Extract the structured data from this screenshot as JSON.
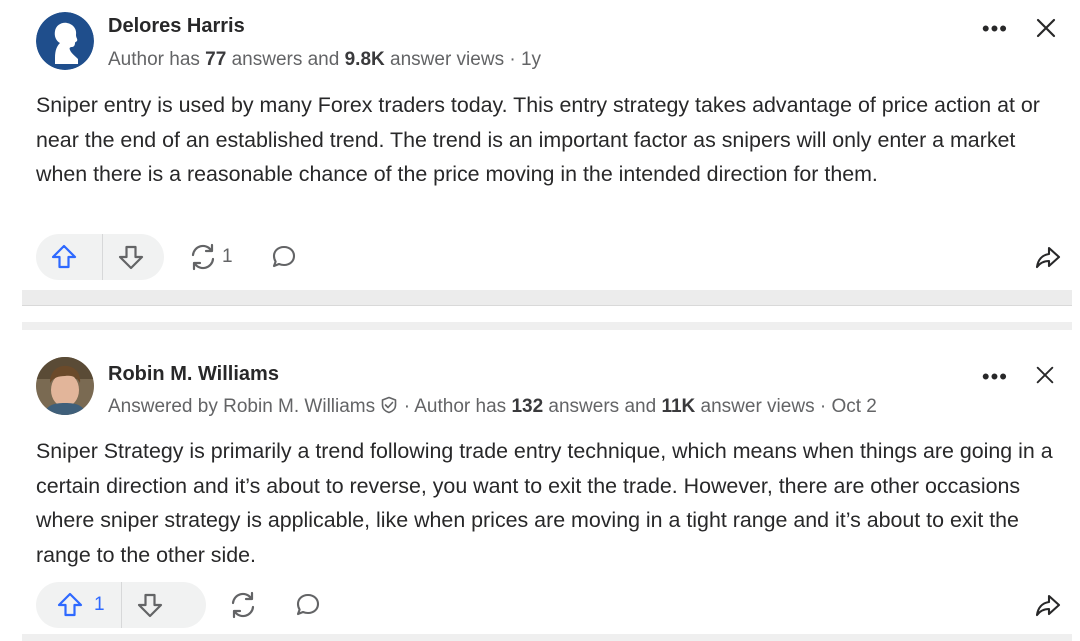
{
  "answers": [
    {
      "author": "Delores Harris",
      "meta_prefix": "Author has ",
      "answer_count": "77",
      "meta_mid": " answers and ",
      "view_count": "9.8K",
      "meta_suffix": " answer views · 1y",
      "body": "Sniper entry is used by many Forex traders today. This entry strategy takes advantage of price action at or near the end of an established trend. The trend is an important factor as snipers will only enter a market when there is a reasonable chance of the price moving in the intended direction for them.",
      "upvotes": "",
      "shares": "1",
      "more_label": "•••"
    },
    {
      "author": "Robin M. Williams",
      "answered_by": "Answered by Robin M. Williams",
      "meta_prefix": " · Author has ",
      "answer_count": "132",
      "meta_mid": " answers and ",
      "view_count": "11K",
      "meta_suffix": " answer views · Oct 2",
      "body": "Sniper Strategy is primarily a trend following trade entry technique, which means when things are going in a certain direction and it’s about to reverse, you want to exit the trade. However, there are other occasions where sniper strategy is applicable, like when prices are moving in a tight range and it’s about to exit the range to the other side.",
      "upvotes": "1",
      "shares": "",
      "more_label": "•••"
    }
  ],
  "colors": {
    "upvote_blue": "#2e69ff",
    "icon_gray": "#636466",
    "avatar_blue": "#1f4e8c"
  },
  "icons": [
    "upvote-icon",
    "downvote-icon",
    "share-icon",
    "comment-icon",
    "forward-icon",
    "close-icon",
    "more-icon",
    "verified-icon"
  ]
}
